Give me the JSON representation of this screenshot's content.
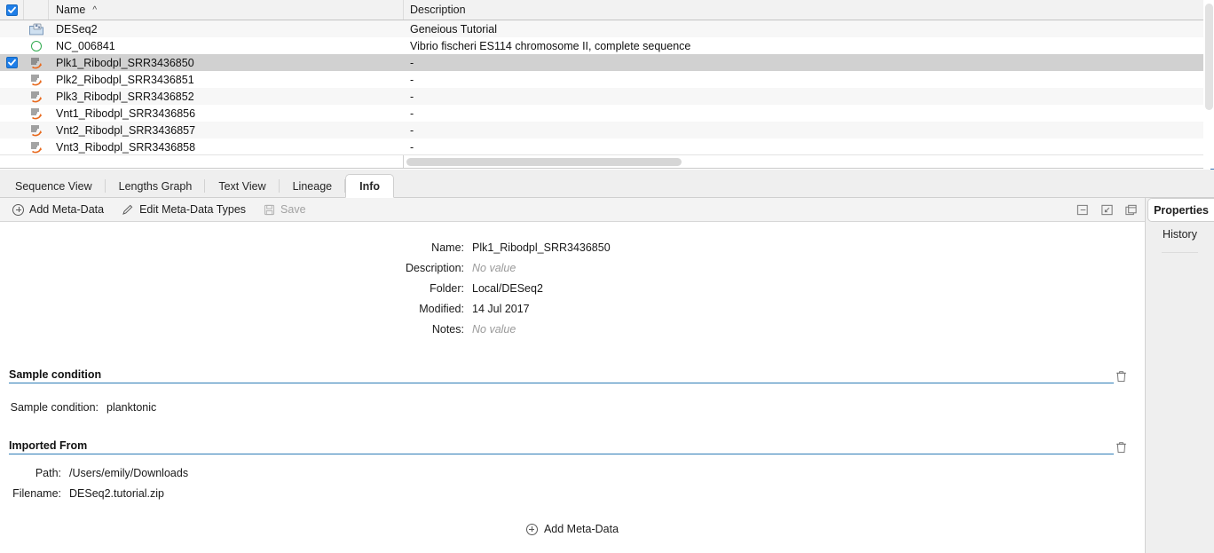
{
  "table": {
    "columns": [
      "",
      "",
      "Name",
      "Description"
    ],
    "header": {
      "checkbox_checked": true,
      "name": "Name",
      "sort_indicator": "^",
      "description": "Description"
    },
    "rows": [
      {
        "checked": false,
        "icon": "folder-icon",
        "name": "DESeq2",
        "description": "Geneious Tutorial"
      },
      {
        "checked": false,
        "icon": "circle-icon",
        "name": "NC_006841",
        "description": "Vibrio fischeri ES114 chromosome II, complete sequence"
      },
      {
        "checked": true,
        "icon": "reads-icon",
        "name": "Plk1_Ribodpl_SRR3436850",
        "description": "-",
        "selected": true
      },
      {
        "checked": false,
        "icon": "reads-icon",
        "name": "Plk2_Ribodpl_SRR3436851",
        "description": "-"
      },
      {
        "checked": false,
        "icon": "reads-icon",
        "name": "Plk3_Ribodpl_SRR3436852",
        "description": "-"
      },
      {
        "checked": false,
        "icon": "reads-icon",
        "name": "Vnt1_Ribodpl_SRR3436856",
        "description": "-"
      },
      {
        "checked": false,
        "icon": "reads-icon",
        "name": "Vnt2_Ribodpl_SRR3436857",
        "description": "-"
      },
      {
        "checked": false,
        "icon": "reads-icon",
        "name": "Vnt3_Ribodpl_SRR3436858",
        "description": "-"
      }
    ]
  },
  "tabs": [
    {
      "label": "Sequence View",
      "active": false
    },
    {
      "label": "Lengths Graph",
      "active": false
    },
    {
      "label": "Text View",
      "active": false
    },
    {
      "label": "Lineage",
      "active": false
    },
    {
      "label": "Info",
      "active": true
    }
  ],
  "toolbar": {
    "add_meta_data": "Add Meta-Data",
    "edit_meta_data_types": "Edit Meta-Data Types",
    "save": "Save",
    "save_enabled": false,
    "icons": [
      "minimize-panel-icon",
      "popout-panel-icon",
      "duplicate-panel-icon"
    ]
  },
  "right_tabs": [
    {
      "label": "Properties",
      "active": true
    },
    {
      "label": "History",
      "active": false
    }
  ],
  "info": {
    "fields": [
      {
        "label": "Name:",
        "value": "Plk1_Ribodpl_SRR3436850",
        "empty": false
      },
      {
        "label": "Description:",
        "value": "No value",
        "empty": true
      },
      {
        "label": "Folder:",
        "value": "Local/DESeq2",
        "empty": false
      },
      {
        "label": "Modified:",
        "value": "14 Jul 2017",
        "empty": false
      },
      {
        "label": "Notes:",
        "value": "No value",
        "empty": true
      }
    ],
    "sections": [
      {
        "title": "Sample condition",
        "rows": [
          {
            "label": "Sample condition:",
            "value": "planktonic"
          }
        ]
      },
      {
        "title": "Imported From",
        "rows": [
          {
            "label": "Path:",
            "value": "/Users/emily/Downloads"
          },
          {
            "label": "Filename:",
            "value": "DESeq2.tutorial.zip"
          }
        ]
      }
    ],
    "add_meta_data_bottom": "Add Meta-Data"
  },
  "colors": {
    "accent_blue": "#2c7bb6",
    "checkbox_blue": "#1e7ee8",
    "selected_row": "#d1d1d1",
    "green_circle": "#2faa4e",
    "reads_orange": "#e8681b"
  }
}
